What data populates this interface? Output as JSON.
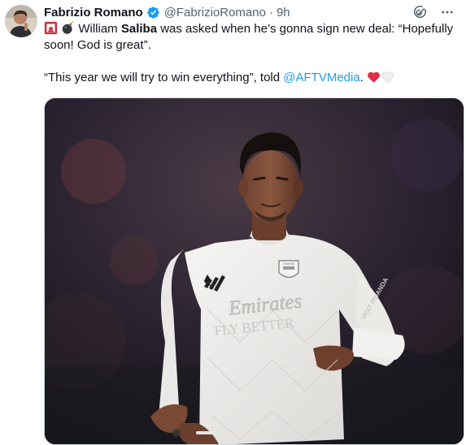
{
  "tweet": {
    "author_name": "Fabrizio Romano",
    "handle": "@FabrizioRomano",
    "separator": "·",
    "time": "9h",
    "text_part1": " William ",
    "text_bold": "Saliba",
    "text_part2": " was asked when he’s gonna sign new deal: “Hopefully soon! God is great”.",
    "text_quote": "“This year we will try to win everything”, told ",
    "text_mention": "@AFTVMedia",
    "text_end": ".",
    "icons": [
      "siren-emoji-icon",
      "bomb-emoji-icon",
      "red-heart-emoji-icon",
      "white-heart-emoji-icon",
      "verified-badge-icon",
      "grok-icon",
      "more-icon"
    ],
    "colors": {
      "link": "#1d9bf0",
      "verified": "#1d9bf0",
      "secondary": "#536471"
    }
  },
  "media": {
    "shirt_sponsor_line1": "Emirates",
    "shirt_sponsor_line2": "FLY BETTER",
    "crest_text": "Arsenal",
    "sleeve_text": "VISIT RWANDA"
  }
}
